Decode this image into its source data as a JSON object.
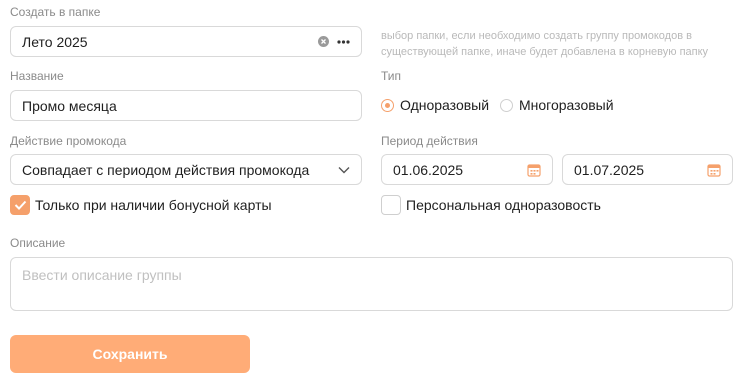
{
  "folder": {
    "label": "Создать в папке",
    "value": "Лето 2025",
    "hint": "выбор папки, если необходимо создать группу промокодов в существующей папке, иначе будет добавлена в корневую папку"
  },
  "name": {
    "label": "Название",
    "value": "Промо месяца"
  },
  "type": {
    "label": "Тип",
    "options": [
      {
        "label": "Одноразовый",
        "selected": true
      },
      {
        "label": "Многоразовый",
        "selected": false
      }
    ]
  },
  "action": {
    "label": "Действие промокода",
    "value": "Совпадает с периодом действия промокода"
  },
  "period": {
    "label": "Период действия",
    "start": "01.06.2025",
    "end": "01.07.2025"
  },
  "bonus_card": {
    "label": "Только при наличии бонусной карты",
    "checked": true
  },
  "personal": {
    "label": "Персональная одноразовость",
    "checked": false
  },
  "description": {
    "label": "Описание",
    "placeholder": "Ввести описание группы",
    "value": ""
  },
  "save_button": {
    "label": "Сохранить"
  },
  "colors": {
    "accent": "#f5a06b",
    "button": "#ffac77"
  }
}
